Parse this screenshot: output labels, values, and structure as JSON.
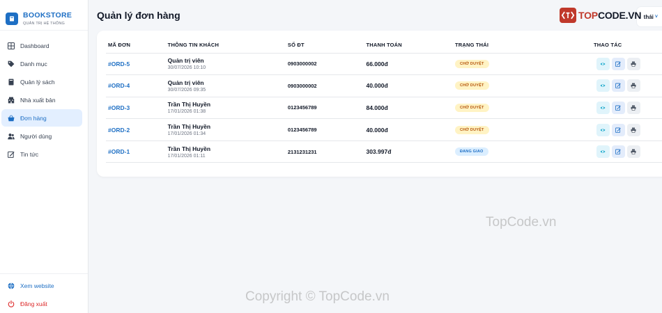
{
  "brand": {
    "title": "BOOKSTORE",
    "subtitle": "QUẢN TRỊ HỆ THỐNG"
  },
  "sidebar": {
    "items": [
      {
        "label": "Dashboard",
        "icon": "dashboard-icon",
        "active": false
      },
      {
        "label": "Danh mục",
        "icon": "tag-icon",
        "active": false
      },
      {
        "label": "Quản lý sách",
        "icon": "book-icon",
        "active": false
      },
      {
        "label": "Nhà xuất bản",
        "icon": "building-icon",
        "active": false
      },
      {
        "label": "Đơn hàng",
        "icon": "basket-icon",
        "active": true
      },
      {
        "label": "Người dùng",
        "icon": "users-icon",
        "active": false
      },
      {
        "label": "Tin tức",
        "icon": "news-icon",
        "active": false
      }
    ],
    "bottom": {
      "website": {
        "label": "Xem website",
        "icon": "globe-icon"
      },
      "logout": {
        "label": "Đăng xuất",
        "icon": "power-icon"
      }
    }
  },
  "header": {
    "title": "Quản lý đơn hàng",
    "user_name": "thái",
    "user_chevron": "˅"
  },
  "table": {
    "headers": {
      "id": "MÃ ĐƠN",
      "customer": "THÔNG TIN KHÁCH",
      "phone": "SỐ ĐT",
      "payment": "THANH TOÁN",
      "status": "TRẠNG THÁI",
      "actions": "THAO TÁC"
    },
    "rows": [
      {
        "id": "#ORD-5",
        "name": "Quản trị viên",
        "time": "30/07/2026 10:10",
        "phone": "0903000002",
        "payment": "66.000đ",
        "status": "CHỜ DUYỆT",
        "status_type": "pending"
      },
      {
        "id": "#ORD-4",
        "name": "Quản trị viên",
        "time": "30/07/2026 09:35",
        "phone": "0903000002",
        "payment": "40.000đ",
        "status": "CHỜ DUYỆT",
        "status_type": "pending"
      },
      {
        "id": "#ORD-3",
        "name": "Trần Thị Huyền",
        "time": "17/01/2026 01:38",
        "phone": "0123456789",
        "payment": "84.000đ",
        "status": "CHỜ DUYỆT",
        "status_type": "pending"
      },
      {
        "id": "#ORD-2",
        "name": "Trần Thị Huyền",
        "time": "17/01/2026 01:34",
        "phone": "0123456789",
        "payment": "40.000đ",
        "status": "CHỜ DUYỆT",
        "status_type": "pending"
      },
      {
        "id": "#ORD-1",
        "name": "Trần Thị Huyền",
        "time": "17/01/2026 01:11",
        "phone": "2131231231",
        "payment": "303.997đ",
        "status": "ĐANG GIAO",
        "status_type": "shipping"
      }
    ]
  },
  "colors": {
    "accent": "#1e6fc4",
    "active_bg": "#e3efff",
    "pending_bg": "#fff3c4",
    "pending_text": "#b45309",
    "shipping_bg": "#dbeeff",
    "logout": "#dc2626"
  },
  "watermarks": {
    "logo_prefix": "TOP",
    "logo_suffix": "CODE.VN",
    "middle": "TopCode.vn",
    "bottom": "Copyright © TopCode.vn"
  }
}
